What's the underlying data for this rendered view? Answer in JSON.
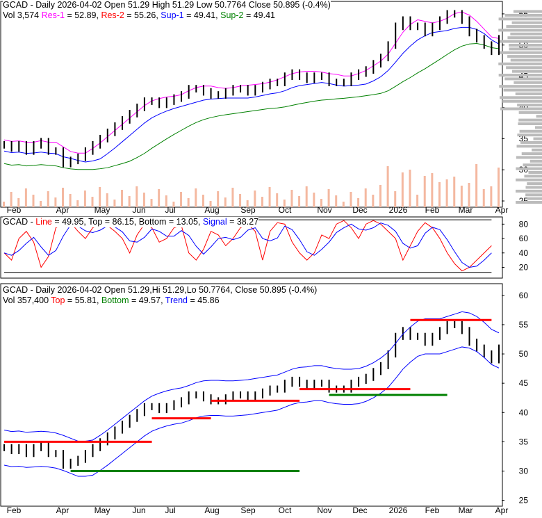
{
  "chart_data": [
    {
      "type": "candlestick",
      "title": "GCAD - Daily 2026-04-02 Open 51.29  High 51.29  Low 50.7764  Close 50.895 (-0.4%)",
      "legend": {
        "vol": "Vol 3,574",
        "items": [
          {
            "label": "Res-1",
            "value": "52.89",
            "color": "#ff00ff"
          },
          {
            "label": "Res-2",
            "value": "55.26",
            "color": "#ff0000"
          },
          {
            "label": "Sup-1",
            "value": "49.41",
            "color": "#0000ff"
          },
          {
            "label": "Sup-2",
            "value": "49.41",
            "color": "#008000"
          }
        ]
      },
      "yticks": [
        25,
        30,
        35,
        40,
        45,
        50,
        55
      ],
      "ylim": [
        24,
        57
      ]
    },
    {
      "type": "line",
      "title": "GCAD",
      "legend": [
        {
          "label": "Line",
          "value": "49.95",
          "color": "#ff0000"
        },
        {
          "label": "Top",
          "value": "86.15",
          "color": "#000000"
        },
        {
          "label": "Bottom",
          "value": "13.05",
          "color": "#000000"
        },
        {
          "label": "Signal",
          "value": "38.27",
          "color": "#0000ff"
        }
      ],
      "yticks": [
        20,
        40,
        60,
        80
      ],
      "ylim": [
        5,
        90
      ]
    },
    {
      "type": "candlestick",
      "title": "GCAD - Daily 2026-04-02 Open 51.29,Hi 51.29,Lo 50.7764, Close 50.895 (-0.4%)",
      "legend": {
        "vol": "Vol 357,400",
        "items": [
          {
            "label": "Top",
            "value": "55.81",
            "color": "#ff0000"
          },
          {
            "label": "Bottom",
            "value": "49.57",
            "color": "#008000"
          },
          {
            "label": "Trend",
            "value": "45.86",
            "color": "#0000ff"
          }
        ]
      },
      "yticks": [
        25,
        30,
        35,
        40,
        45,
        50,
        55,
        60
      ],
      "ylim": [
        24,
        62
      ]
    }
  ],
  "xticks": [
    "Feb",
    "Apr",
    "May",
    "Jun",
    "Jul",
    "Aug",
    "Sep",
    "Oct",
    "Nov",
    "Dec",
    "2026",
    "Feb",
    "Mar",
    "Apr"
  ],
  "closes": [
    34,
    33.5,
    34,
    33,
    34,
    34.5,
    33,
    33,
    31,
    31.5,
    32,
    33,
    34,
    35,
    36,
    37,
    38,
    39,
    40,
    41,
    41,
    40.5,
    41,
    41.5,
    42,
    43,
    43,
    42.5,
    42,
    42,
    42.5,
    43,
    43,
    42.5,
    43,
    43.5,
    44,
    44,
    45,
    45.5,
    45,
    44.5,
    45,
    45,
    44,
    44,
    44,
    45,
    45.5,
    46,
    47,
    48,
    50,
    53,
    54,
    53,
    53,
    52,
    53,
    54,
    55,
    55,
    54,
    52,
    51,
    50,
    49,
    51
  ],
  "osc_line": [
    40,
    30,
    60,
    70,
    55,
    20,
    35,
    75,
    80,
    82,
    70,
    60,
    75,
    80,
    78,
    70,
    60,
    40,
    65,
    80,
    75,
    55,
    60,
    75,
    78,
    40,
    30,
    45,
    70,
    65,
    50,
    60,
    75,
    80,
    70,
    30,
    70,
    82,
    80,
    55,
    40,
    30,
    40,
    65,
    60,
    80,
    85,
    75,
    60,
    80,
    85,
    80,
    70,
    60,
    30,
    50,
    70,
    82,
    75,
    60,
    40,
    25,
    15,
    20,
    30,
    40,
    50
  ]
}
